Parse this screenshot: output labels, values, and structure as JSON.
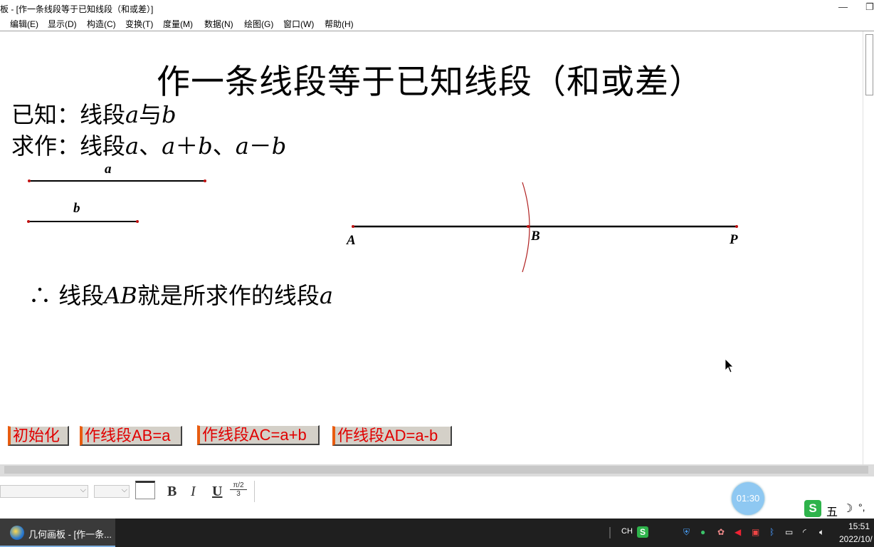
{
  "window": {
    "title": "板 - [作一条线段等于已知线段（和或差）]",
    "minimize_glyph": "—",
    "restore_glyph": "❐"
  },
  "menu": [
    "编辑(E)",
    "显示(D)",
    "构造(C)",
    "变换(T)",
    "度量(M)",
    "数据(N)",
    "绘图(G)",
    "窗口(W)",
    "帮助(H)"
  ],
  "sketch": {
    "heading": "作一条线段等于已知线段（和或差）",
    "known_prefix": "已知：线段",
    "known_a": "a",
    "known_mid": "与",
    "known_b": "b",
    "construct_prefix": "求作：线段",
    "construct_a": "a",
    "construct_sep1": "、",
    "construct_a2": "a",
    "construct_plus": "＋",
    "construct_b": "b",
    "construct_sep2": "、",
    "construct_a3": "a",
    "construct_minus": "－",
    "construct_b2": "b",
    "conclusion_prefix": "∴  线段",
    "conclusion_ab": "AB",
    "conclusion_mid": "就是所求作的线段",
    "conclusion_a": "a",
    "segment_a_label": "a",
    "segment_b_label": "b",
    "point_A": "A",
    "point_B": "B",
    "point_P": "P"
  },
  "action_buttons": [
    "初始化",
    "作线段AB=a",
    "作线段AC=a+b",
    "作线段AD=a-b"
  ],
  "format_toolbar": {
    "bold": "B",
    "italic": "I",
    "underline": "U",
    "math_top": "π/2",
    "math_bottom": "3"
  },
  "timer": "01:30",
  "ime": {
    "mode": "五",
    "moon": "☽",
    "punct": "°,"
  },
  "taskbar": {
    "app_label": "几何画板 - [作一条...",
    "lang": "CH",
    "time": "15:51",
    "date": "2022/10/"
  },
  "colors": {
    "button_text": "#e00000",
    "button_accent": "#e85c10",
    "arc": "#b02020",
    "point": "#c01010"
  }
}
